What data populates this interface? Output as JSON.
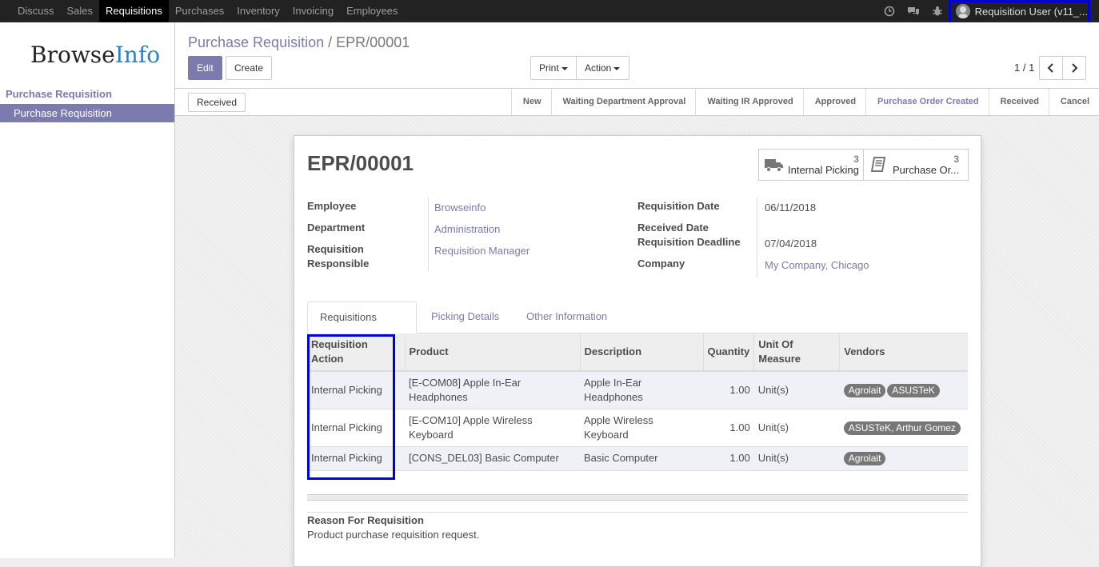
{
  "topbar": {
    "menu": [
      "Discuss",
      "Sales",
      "Requisitions",
      "Purchases",
      "Inventory",
      "Invoicing",
      "Employees"
    ],
    "active_menu": "Requisitions",
    "icons": [
      "clock-icon",
      "chat-icon",
      "bug-icon"
    ],
    "user": "Requisition User (v11_..."
  },
  "sidebar": {
    "brand_part1": "Browse",
    "brand_part2": "Info",
    "section": "Purchase Requisition",
    "item": "Purchase Requisition"
  },
  "control_panel": {
    "breadcrumb_parent": "Purchase Requisition",
    "breadcrumb_sep": "/",
    "breadcrumb_current": "EPR/00001",
    "edit": "Edit",
    "create": "Create",
    "print": "Print",
    "action": "Action",
    "pager": "1 / 1"
  },
  "statusbar": {
    "received_button": "Received",
    "stages": [
      "New",
      "Waiting Department Approval",
      "Waiting IR Approved",
      "Approved",
      "Purchase Order Created",
      "Received",
      "Cancel"
    ],
    "current_stage": "Purchase Order Created"
  },
  "form": {
    "title": "EPR/00001",
    "smart_buttons": [
      {
        "count": "3",
        "label": "Internal Picking",
        "icon": "truck-icon"
      },
      {
        "count": "3",
        "label": "Purchase Or...",
        "icon": "book-icon"
      }
    ],
    "left_fields": {
      "employee_label": "Employee",
      "employee_value": "Browseinfo",
      "department_label": "Department",
      "department_value": "Administration",
      "responsible_label1": "Requisition",
      "responsible_label2": "Responsible",
      "responsible_value": "Requisition Manager"
    },
    "right_fields": {
      "req_date_label": "Requisition Date",
      "req_date_value": "06/11/2018",
      "received_date_label": "Received Date",
      "deadline_label": "Requisition Deadline",
      "deadline_value": "07/04/2018",
      "company_label": "Company",
      "company_value": "My Company, Chicago"
    },
    "tabs": [
      "Requisitions Lines",
      "Picking Details",
      "Other Information"
    ],
    "active_tab": "Requisitions Lines",
    "columns": {
      "action1": "Requisition",
      "action2": "Action",
      "product": "Product",
      "description": "Description",
      "quantity": "Quantity",
      "uom1": "Unit Of",
      "uom2": "Measure",
      "vendors": "Vendors"
    },
    "lines": [
      {
        "action": "Internal Picking",
        "product1": "[E-COM08] Apple In-Ear",
        "product2": "Headphones",
        "desc1": "Apple In-Ear",
        "desc2": "Headphones",
        "qty": "1.00",
        "uom": "Unit(s)",
        "vendors": [
          "Agrolait",
          "ASUSTeK"
        ]
      },
      {
        "action": "Internal Picking",
        "product1": "[E-COM10] Apple Wireless",
        "product2": "Keyboard",
        "desc1": "Apple Wireless",
        "desc2": "Keyboard",
        "qty": "1.00",
        "uom": "Unit(s)",
        "vendors": [
          "ASUSTeK, Arthur Gomez"
        ]
      },
      {
        "action": "Internal Picking",
        "product1": "[CONS_DEL03] Basic Computer",
        "product2": "",
        "desc1": "Basic Computer",
        "desc2": "",
        "qty": "1.00",
        "uom": "Unit(s)",
        "vendors": [
          "Agrolait"
        ]
      }
    ],
    "reason_label": "Reason For Requisition",
    "reason_value": "Product purchase requisition request."
  },
  "colors": {
    "accent": "#7c7bad",
    "highlight": "#0000d8",
    "topbar": "#222222"
  }
}
